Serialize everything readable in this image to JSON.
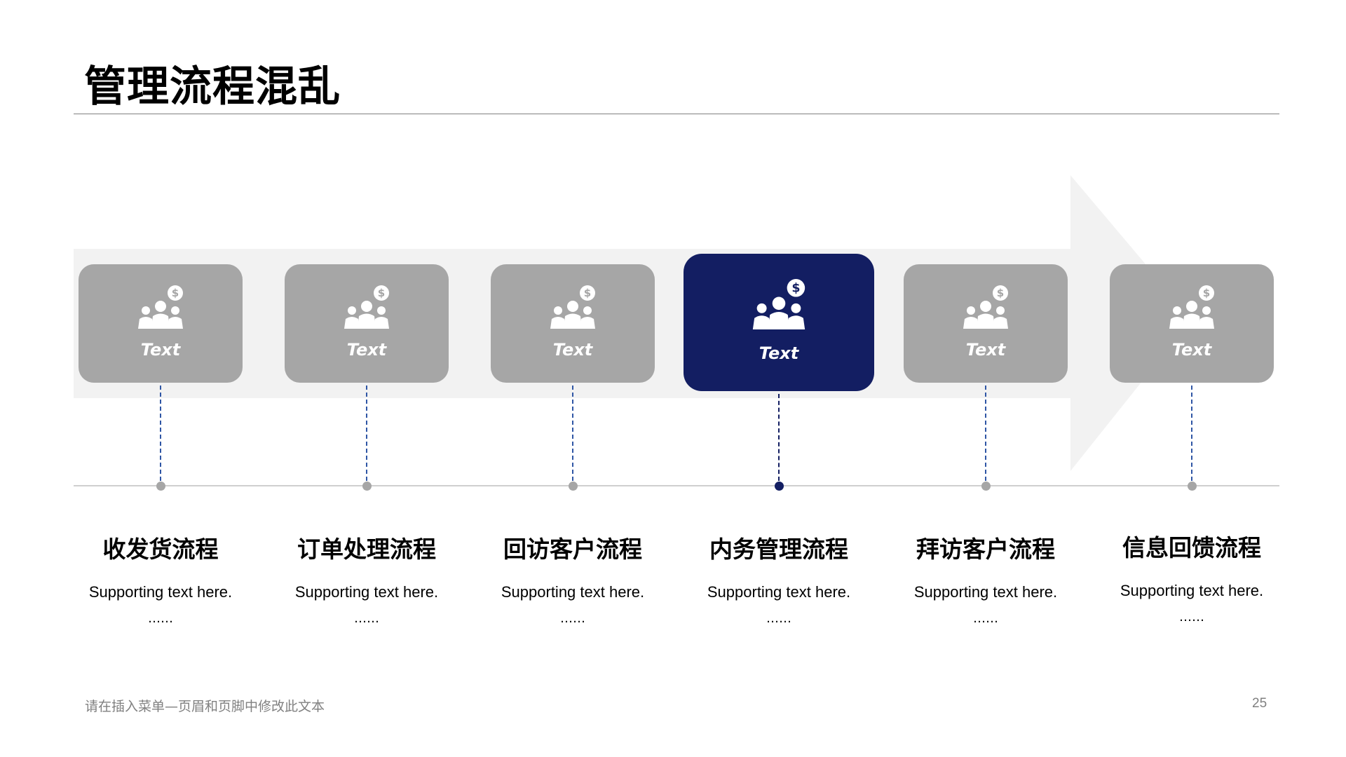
{
  "slide": {
    "title": "管理流程混乱",
    "footer_note": "请在插入菜单—页眉和页脚中修改此文本",
    "page_number": "25"
  },
  "colors": {
    "card_gray": "#a6a6a6",
    "card_active": "#131e62",
    "connector_blue": "#2f56a5",
    "arrow_bg": "#f2f2f2",
    "timeline": "#cfcfcf"
  },
  "steps": [
    {
      "card_label": "Text",
      "title": "收发货流程",
      "text": "Supporting text here.",
      "dots": "……",
      "icon": "people-dollar-icon",
      "active": false
    },
    {
      "card_label": "Text",
      "title": "订单处理流程",
      "text": "Supporting text here.",
      "dots": "……",
      "icon": "people-dollar-icon",
      "active": false
    },
    {
      "card_label": "Text",
      "title": "回访客户流程",
      "text": "Supporting text here.",
      "dots": "……",
      "icon": "people-dollar-icon",
      "active": false
    },
    {
      "card_label": "Text",
      "title": "内务管理流程",
      "text": "Supporting text here.",
      "dots": "……",
      "icon": "people-dollar-icon",
      "active": true
    },
    {
      "card_label": "Text",
      "title": "拜访客户流程",
      "text": "Supporting text here.",
      "dots": "……",
      "icon": "people-dollar-icon",
      "active": false
    },
    {
      "card_label": "Text",
      "title": "信息回馈流程",
      "text": "Supporting text here.",
      "dots": "……",
      "icon": "people-dollar-icon",
      "active": false
    }
  ]
}
